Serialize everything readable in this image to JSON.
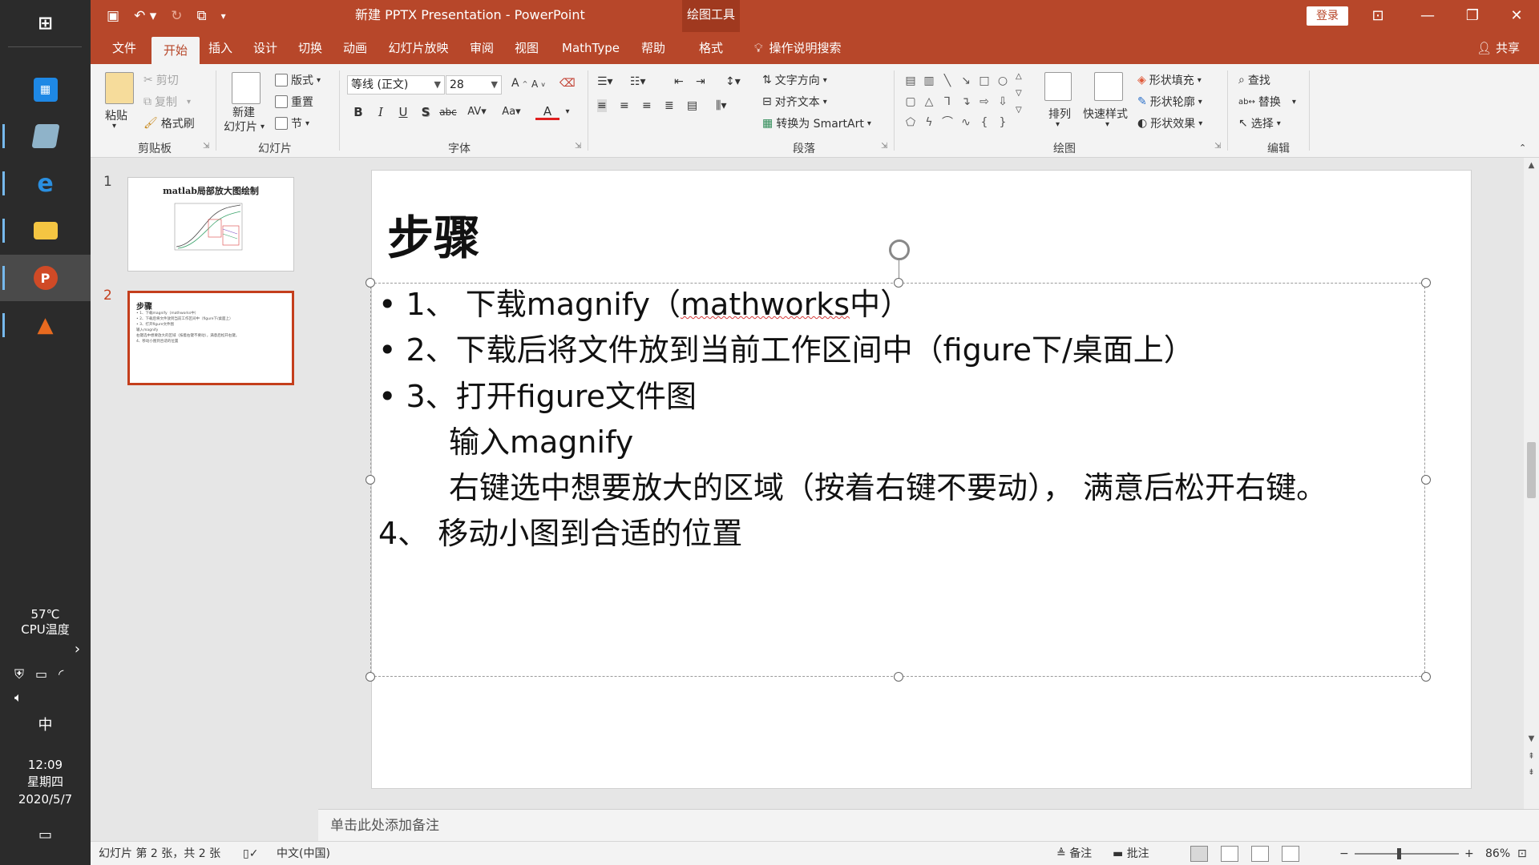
{
  "taskbar": {
    "temperature": "57℃",
    "cpu_label": "CPU温度",
    "ime": "中",
    "time": "12:09",
    "weekday": "星期四",
    "date": "2020/5/7"
  },
  "titlebar": {
    "title": "新建 PPTX Presentation  -  PowerPoint",
    "drawing_tools": "绘图工具",
    "login": "登录"
  },
  "tabs": {
    "file": "文件",
    "home": "开始",
    "insert": "插入",
    "design": "设计",
    "transitions": "切换",
    "animations": "动画",
    "slideshow": "幻灯片放映",
    "review": "审阅",
    "view": "视图",
    "mathtype": "MathType",
    "help": "帮助",
    "format": "格式",
    "tellme": "操作说明搜索",
    "share": "共享"
  },
  "ribbon": {
    "clipboard": {
      "paste": "粘贴",
      "cut": "剪切",
      "copy": "复制",
      "format_painter": "格式刷",
      "label": "剪贴板"
    },
    "slides": {
      "new_slide_1": "新建",
      "new_slide_2": "幻灯片",
      "layout": "版式",
      "reset": "重置",
      "section": "节",
      "label": "幻灯片"
    },
    "font": {
      "font_name": "等线 (正文)",
      "font_size": "28",
      "label": "字体"
    },
    "paragraph": {
      "text_direction": "文字方向",
      "align_text": "对齐文本",
      "smartart": "转换为 SmartArt",
      "label": "段落"
    },
    "drawing": {
      "arrange": "排列",
      "quick_styles": "快速样式",
      "shape_fill": "形状填充",
      "shape_outline": "形状轮廓",
      "shape_effects": "形状效果",
      "label": "绘图"
    },
    "editing": {
      "find": "查找",
      "replace": "替换",
      "select": "选择",
      "label": "编辑"
    }
  },
  "thumbnails": [
    {
      "number": "1",
      "title": "matlab局部放大图绘制"
    },
    {
      "number": "2",
      "title": "步骤",
      "lines": [
        "• 1、下载magnify（mathworks中）",
        "• 2、下载后将文件放到当前工作区间中（figure下/桌面上）",
        "• 3、打开figure文件图",
        "    输入magnify",
        "    右键选中想要放大的区域（按着右键不要动），满意后松开右键。",
        "4、移动小图到合适的位置"
      ]
    }
  ],
  "slide": {
    "title": "步骤",
    "line1_pre": "• 1、 下载magnify（",
    "line1_err": "mathworks",
    "line1_post": "中）",
    "line2": "• 2、下载后将文件放到当前工作区间中（figure下/桌面上）",
    "line3": "• 3、打开figure文件图",
    "line4": "输入magnify",
    "line5": "右键选中想要放大的区域（按着右键不要动），  满意后松开右键。",
    "line6": "4、 移动小图到合适的位置"
  },
  "notes_placeholder": "单击此处添加备注",
  "status": {
    "slide_info": "幻灯片 第 2 张，共 2 张",
    "language": "中文(中国)",
    "notes": "备注",
    "comments": "批注",
    "zoom": "86%"
  }
}
